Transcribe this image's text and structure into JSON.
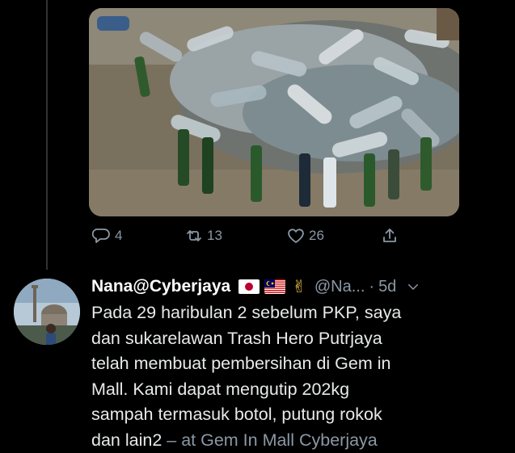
{
  "tweet_actions": {
    "reply_count": "4",
    "retweet_count": "13",
    "like_count": "26"
  },
  "reply": {
    "display_name": "Nana@Cyberjaya",
    "handle": "@Na...",
    "separator": "·",
    "timestamp": "5d",
    "emojis": [
      "japan-flag",
      "malaysia-flag",
      "victory-hand"
    ],
    "text_lines": [
      "Pada 29 haribulan 2 sebelum PKP, saya",
      "dan sukarelawan Trash Hero Putrjaya",
      "telah membuat pembersihan di Gem in",
      "Mall. Kami dapat mengutip 202kg",
      "sampah termasuk botol, putung rokok",
      "dan lain2"
    ],
    "location": "– at Gem In Mall Cyberjaya"
  },
  "colors": {
    "background": "#000000",
    "text": "#e7e9ea",
    "muted": "#8b98a5"
  }
}
